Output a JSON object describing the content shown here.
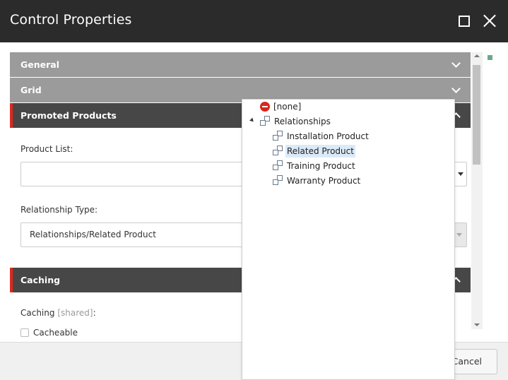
{
  "window": {
    "title": "Control Properties"
  },
  "sections": {
    "general": {
      "label": "General"
    },
    "grid": {
      "label": "Grid"
    },
    "promoted_products": {
      "label": "Promoted Products"
    },
    "caching": {
      "label": "Caching"
    }
  },
  "fields": {
    "product_list": {
      "label": "Product List:",
      "value": ""
    },
    "relationship_type": {
      "label": "Relationship Type:",
      "value": "Relationships/Related Product"
    },
    "caching": {
      "label": "Caching",
      "shared_tag": "[shared]",
      "suffix": ":",
      "checkbox_label": "Cacheable"
    }
  },
  "tree": {
    "none_label": "[none]",
    "root_label": "Relationships",
    "children": [
      {
        "label": "Installation Product",
        "selected": false
      },
      {
        "label": "Related Product",
        "selected": true
      },
      {
        "label": "Training Product",
        "selected": false
      },
      {
        "label": "Warranty Product",
        "selected": false
      }
    ]
  },
  "footer": {
    "cancel_label": "Cancel"
  },
  "colors": {
    "titlebar": "#2b2b2b",
    "section_light": "#9b9b9b",
    "section_dark": "#474747",
    "accent_red": "#dc291e",
    "selection": "#dbeaf7"
  },
  "icons": {
    "maximize": "maximize-icon",
    "close": "close-icon",
    "expand": "chevron-down-icon",
    "collapse": "chevron-up-icon",
    "none": "no-entry-icon",
    "relationship": "relationship-link-icon"
  }
}
